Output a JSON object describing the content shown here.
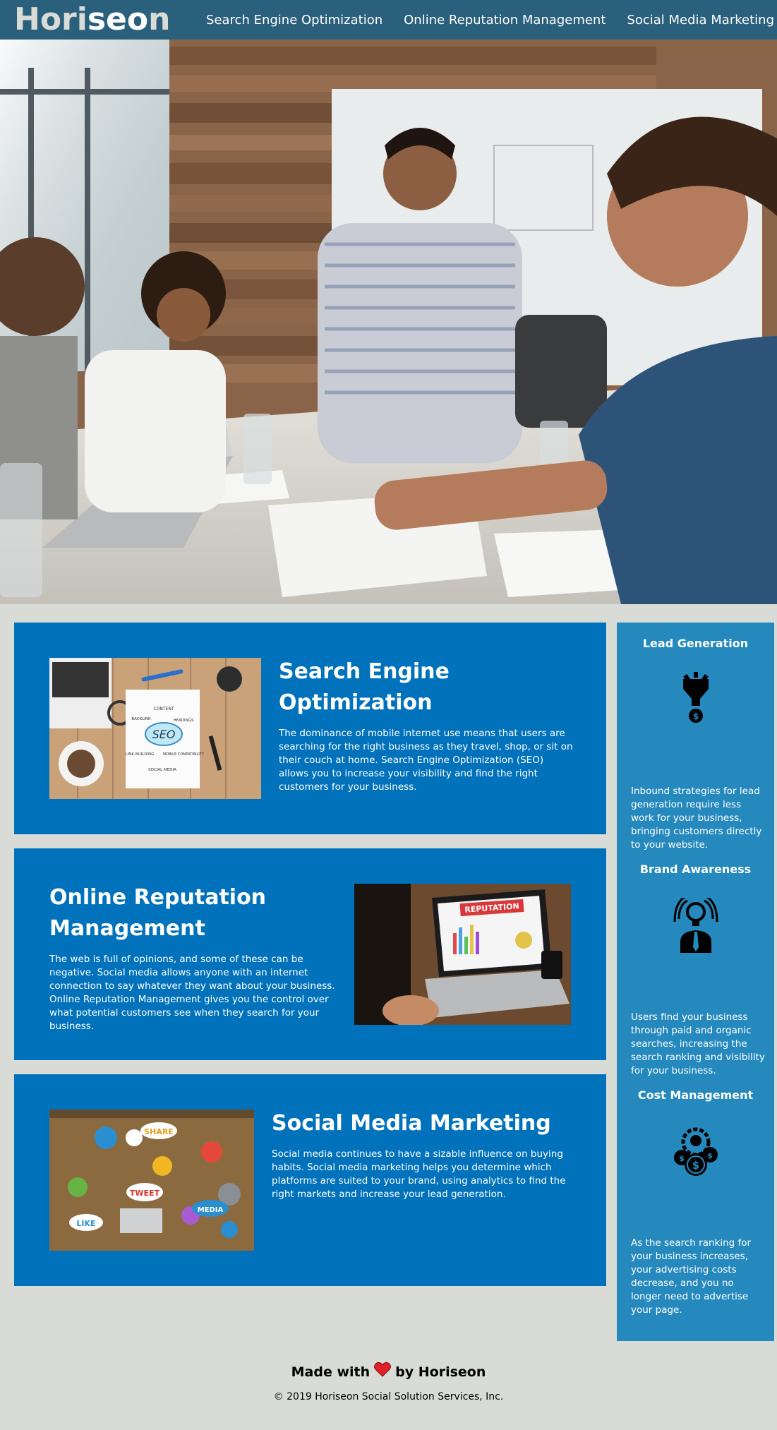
{
  "header": {
    "logo_prefix": "Hori",
    "logo_highlight": "seo",
    "logo_suffix": "n",
    "nav": [
      {
        "label": "Search Engine Optimization"
      },
      {
        "label": "Online Reputation Management"
      },
      {
        "label": "Social Media Marketing"
      }
    ]
  },
  "content": [
    {
      "title": "Search Engine Optimization",
      "text": "The dominance of mobile internet use means that users are searching for the right business as they travel, shop, or sit on their couch at home. Search Engine Optimization (SEO) allows you to increase your visibility and find the right customers for your business.",
      "image_words": {
        "seo": "SEO",
        "content": "CONTENT",
        "backlink": "BACKLINK",
        "headings": "HEADINGS",
        "link_building": "LINK BUILDING",
        "mobile": "MOBILE COMPATIBILITY",
        "social": "SOCIAL MEDIA"
      }
    },
    {
      "title": "Online Reputation Management",
      "text": "The web is full of opinions, and some of these can be negative. Social media allows anyone with an internet connection to say whatever they want about your business. Online Reputation Management gives you the control over what potential customers see when they search for your business.",
      "image_words": {
        "reputation": "REPUTATION"
      }
    },
    {
      "title": "Social Media Marketing",
      "text": "Social media continues to have a sizable influence on buying habits. Social media marketing helps you determine which platforms are suited to your brand, using analytics to find the right markets and increase your lead generation.",
      "image_words": {
        "share": "SHARE",
        "tweet": "TWEET",
        "like": "LIKE",
        "media": "MEDIA"
      }
    }
  ],
  "benefits": [
    {
      "title": "Lead Generation",
      "icon": "lead-generation-icon",
      "text": "Inbound strategies for lead generation require less work for your business, bringing customers directly to your website."
    },
    {
      "title": "Brand Awareness",
      "icon": "brand-awareness-icon",
      "text": "Users find your business through paid and organic searches, increasing the search ranking and visibility for your business."
    },
    {
      "title": "Cost Management",
      "icon": "cost-management-icon",
      "text": "As the search ranking for your business increases, your advertising costs decrease, and you no longer need to advertise your page."
    }
  ],
  "footer": {
    "made_with": "Made with",
    "by": "by Horiseon",
    "copyright": "© 2019 Horiseon Social Solution Services, Inc."
  },
  "colors": {
    "header": "#2a607c",
    "page_bg": "#d9dcd6",
    "card": "#0072bb",
    "sidebar": "#2589bd",
    "heart": "#e0202a"
  }
}
